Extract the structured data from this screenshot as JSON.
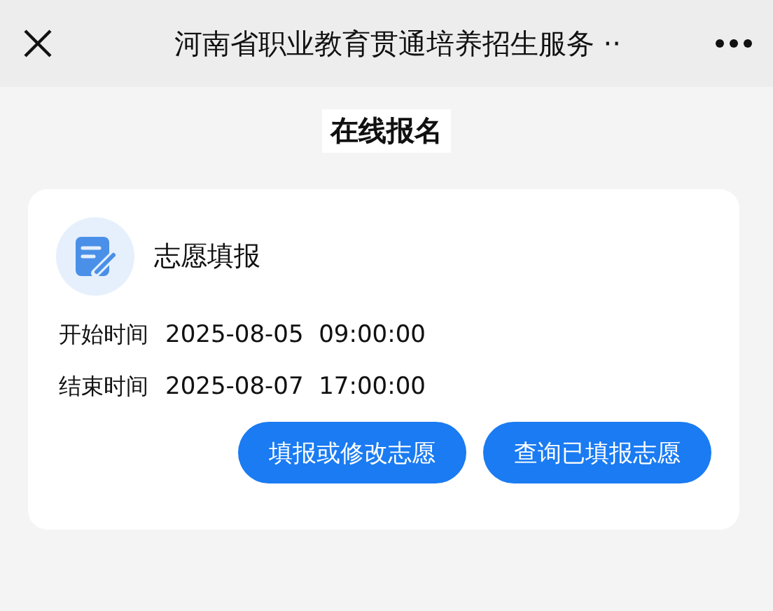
{
  "nav_bar": {
    "title": "河南省职业教育贯通培养招生服务 ··"
  },
  "page_heading": "在线报名",
  "card": {
    "title": "志愿填报",
    "rows": [
      {
        "label": "开始时间",
        "value": "2025-08-05  09:00:00"
      },
      {
        "label": "结束时间",
        "value": "2025-08-07  17:00:00"
      }
    ],
    "buttons": [
      "填报或修改志愿",
      "查询已填报志愿"
    ]
  }
}
